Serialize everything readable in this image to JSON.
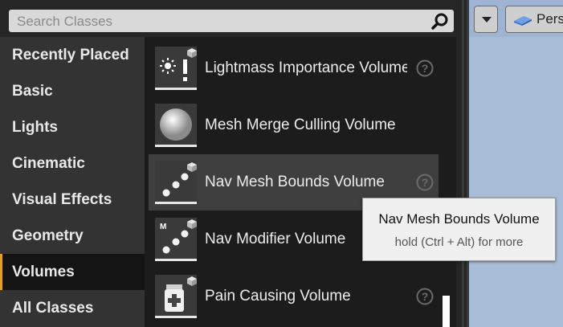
{
  "search": {
    "placeholder": "Search Classes",
    "value": ""
  },
  "categories": [
    {
      "label": "Recently Placed",
      "active": false
    },
    {
      "label": "Basic",
      "active": false
    },
    {
      "label": "Lights",
      "active": false
    },
    {
      "label": "Cinematic",
      "active": false
    },
    {
      "label": "Visual Effects",
      "active": false
    },
    {
      "label": "Geometry",
      "active": false
    },
    {
      "label": "Volumes",
      "active": true
    },
    {
      "label": "All Classes",
      "active": false
    }
  ],
  "items": [
    {
      "label": "Lightmass Importance Volume",
      "icon": "lightmass-volume-icon",
      "help": true
    },
    {
      "label": "Mesh Merge Culling Volume",
      "icon": "sphere-icon",
      "help": false
    },
    {
      "label": "Nav Mesh Bounds Volume",
      "icon": "nav-mesh-volume-icon",
      "help": true,
      "highlighted": true
    },
    {
      "label": "Nav Modifier Volume",
      "icon": "nav-modifier-volume-icon",
      "help": false
    },
    {
      "label": "Pain Causing Volume",
      "icon": "pain-volume-icon",
      "help": true
    }
  ],
  "tooltip": {
    "title": "Nav Mesh Bounds Volume",
    "hint": "hold (Ctrl + Alt) for more"
  },
  "viewport": {
    "perspective_label": "Pers"
  },
  "colors": {
    "accent": "#e0a020",
    "viewport_bg": "#a9bdd8",
    "panel": "#262626"
  }
}
